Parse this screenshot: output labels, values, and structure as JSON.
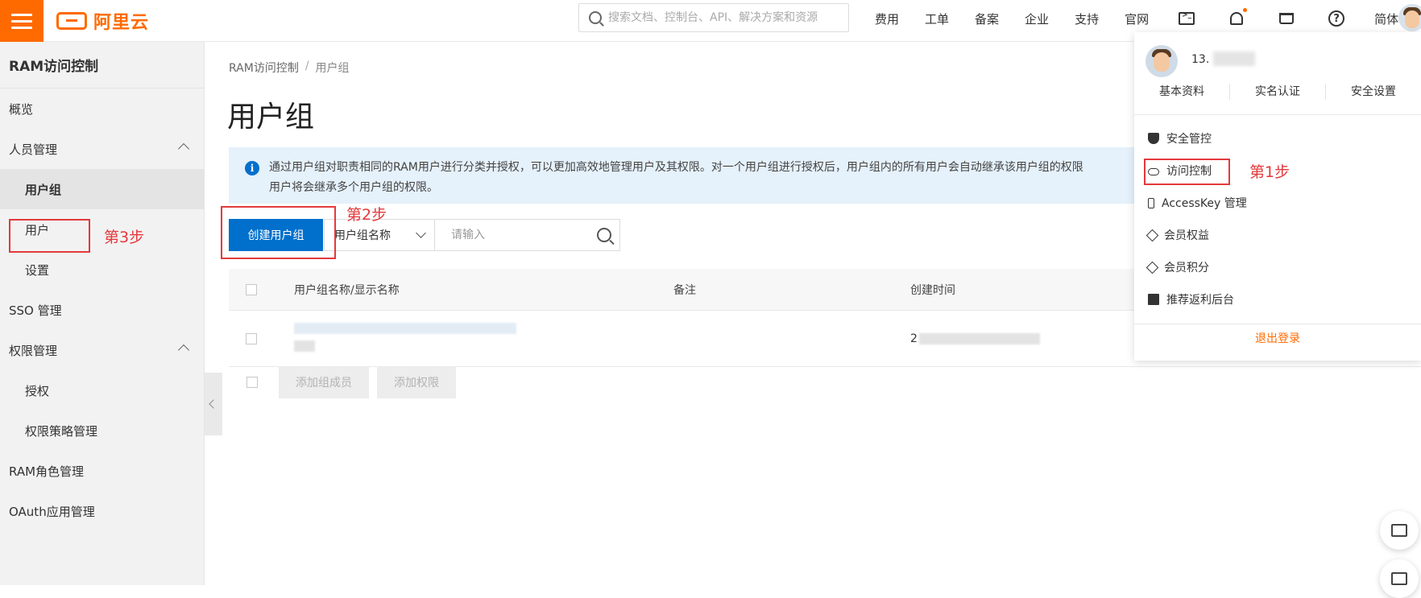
{
  "topbar": {
    "logo_text": "阿里云",
    "search_placeholder": "搜索文档、控制台、API、解决方案和资源",
    "nav": [
      "费用",
      "工单",
      "备案",
      "企业",
      "支持",
      "官网"
    ],
    "lang": "简体",
    "colors": {
      "brand": "#ff6a00"
    }
  },
  "sidebar": {
    "title": "RAM访问控制",
    "items": [
      {
        "label": "概览"
      },
      {
        "label": "人员管理"
      },
      {
        "label": "用户组"
      },
      {
        "label": "用户"
      },
      {
        "label": "设置"
      },
      {
        "label": "SSO 管理"
      },
      {
        "label": "权限管理"
      },
      {
        "label": "授权"
      },
      {
        "label": "权限策略管理"
      },
      {
        "label": "RAM角色管理"
      },
      {
        "label": "OAuth应用管理"
      }
    ]
  },
  "main": {
    "breadcrumb": {
      "root": "RAM访问控制",
      "sep": "/",
      "current": "用户组"
    },
    "title": "用户组",
    "notice_line1": "通过用户组对职责相同的RAM用户进行分类并授权，可以更加高效地管理用户及其权限。对一个用户组进行授权后，用户组内的所有用户会自动继承该用户组的权限",
    "notice_line2": "用户将会继承多个用户组的权限。",
    "create_button": "创建用户组",
    "filter_select": "用户组名称",
    "search_placeholder": "请输入",
    "table": {
      "headers": [
        "用户组名称/显示名称",
        "备注",
        "创建时间"
      ],
      "row_time_prefix": "2"
    },
    "bulk_add_members": "添加组成员",
    "bulk_add_permissions": "添加权限"
  },
  "annotations": {
    "step1": "第1步",
    "step2": "第2步",
    "step3": "第3步",
    "color": "#e4393c"
  },
  "account_menu": {
    "phone_prefix": "13.",
    "links": [
      "基本资料",
      "实名认证",
      "安全设置"
    ],
    "items": [
      {
        "label": "安全管控",
        "icon": "shield-icon"
      },
      {
        "label": "访问控制",
        "icon": "cloud-icon"
      },
      {
        "label": "AccessKey 管理",
        "icon": "key-icon"
      },
      {
        "label": "会员权益",
        "icon": "diamond-icon"
      },
      {
        "label": "会员积分",
        "icon": "diamond-icon"
      },
      {
        "label": "推荐返利后台",
        "icon": "book-icon"
      }
    ],
    "logout": "退出登录"
  }
}
